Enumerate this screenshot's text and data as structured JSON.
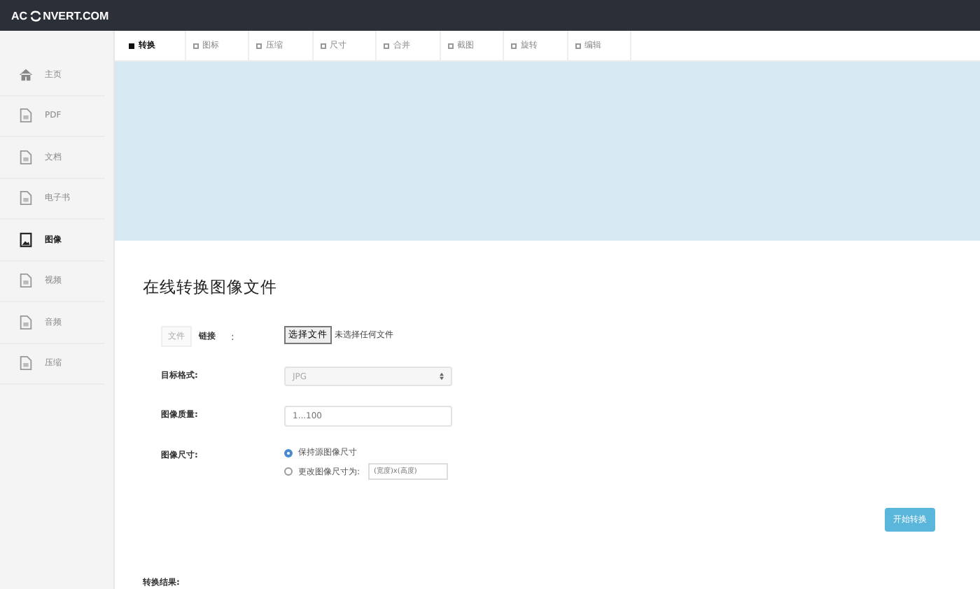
{
  "header": {
    "logo_left": "AC",
    "logo_right": "NVERT.COM"
  },
  "tabs": [
    {
      "label": "转换",
      "selected": true
    },
    {
      "label": "图标",
      "selected": false
    },
    {
      "label": "压缩",
      "selected": false
    },
    {
      "label": "尺寸",
      "selected": false
    },
    {
      "label": "合并",
      "selected": false
    },
    {
      "label": "截图",
      "selected": false
    },
    {
      "label": "旋转",
      "selected": false
    },
    {
      "label": "编辑",
      "selected": false
    }
  ],
  "sidebar": {
    "items": [
      {
        "label": "主页",
        "kind": "home",
        "selected": false
      },
      {
        "label": "PDF",
        "kind": "file",
        "selected": false
      },
      {
        "label": "文档",
        "kind": "file",
        "selected": false
      },
      {
        "label": "电子书",
        "kind": "file",
        "selected": false
      },
      {
        "label": "图像",
        "kind": "image",
        "selected": true
      },
      {
        "label": "视频",
        "kind": "file",
        "selected": false
      },
      {
        "label": "音频",
        "kind": "file",
        "selected": false
      },
      {
        "label": "压缩",
        "kind": "file",
        "selected": false
      }
    ]
  },
  "title": "在线转换图像文件",
  "source": {
    "options": [
      {
        "label": "文件",
        "selected": false
      },
      {
        "label": "链接",
        "selected": true
      }
    ],
    "colon": ":",
    "file_button": "选择文件",
    "file_status": "未选择任何文件"
  },
  "target_format": {
    "label": "目标格式:",
    "value": "JPG"
  },
  "quality": {
    "label": "图像质量:",
    "placeholder": "1...100"
  },
  "size": {
    "label": "图像尺寸:",
    "options": [
      {
        "label": "保持源图像尺寸",
        "selected": true
      },
      {
        "label": "更改图像尺寸为:",
        "selected": false
      }
    ],
    "placeholder": "(宽度)x(高度)"
  },
  "submit": "开始转换",
  "result_label": "转换结果:"
}
